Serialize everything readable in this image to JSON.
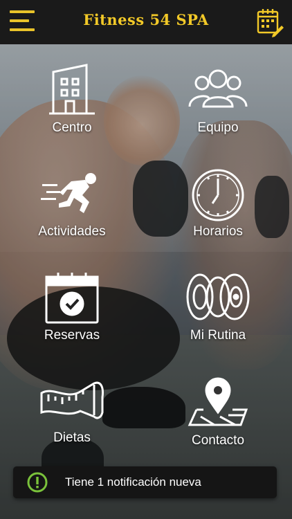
{
  "header": {
    "title": "Fitness 54 SPA",
    "accent_color": "#f2c928",
    "menu_icon": "hamburger-menu-icon",
    "calendar_icon": "calendar-edit-icon"
  },
  "grid": {
    "items": [
      {
        "label": "Centro",
        "icon": "building-icon"
      },
      {
        "label": "Equipo",
        "icon": "group-icon"
      },
      {
        "label": "Actividades",
        "icon": "running-icon"
      },
      {
        "label": "Horarios",
        "icon": "clock-icon"
      },
      {
        "label": "Reservas",
        "icon": "calendar-check-icon"
      },
      {
        "label": "Mi Rutina",
        "icon": "weight-plates-icon"
      },
      {
        "label": "Dietas",
        "icon": "measuring-tape-icon"
      },
      {
        "label": "Contacto",
        "icon": "map-pin-icon"
      }
    ]
  },
  "notification": {
    "text": "Tiene 1 notificación nueva",
    "icon": "alert-circle-icon",
    "icon_color": "#7ac23b"
  }
}
